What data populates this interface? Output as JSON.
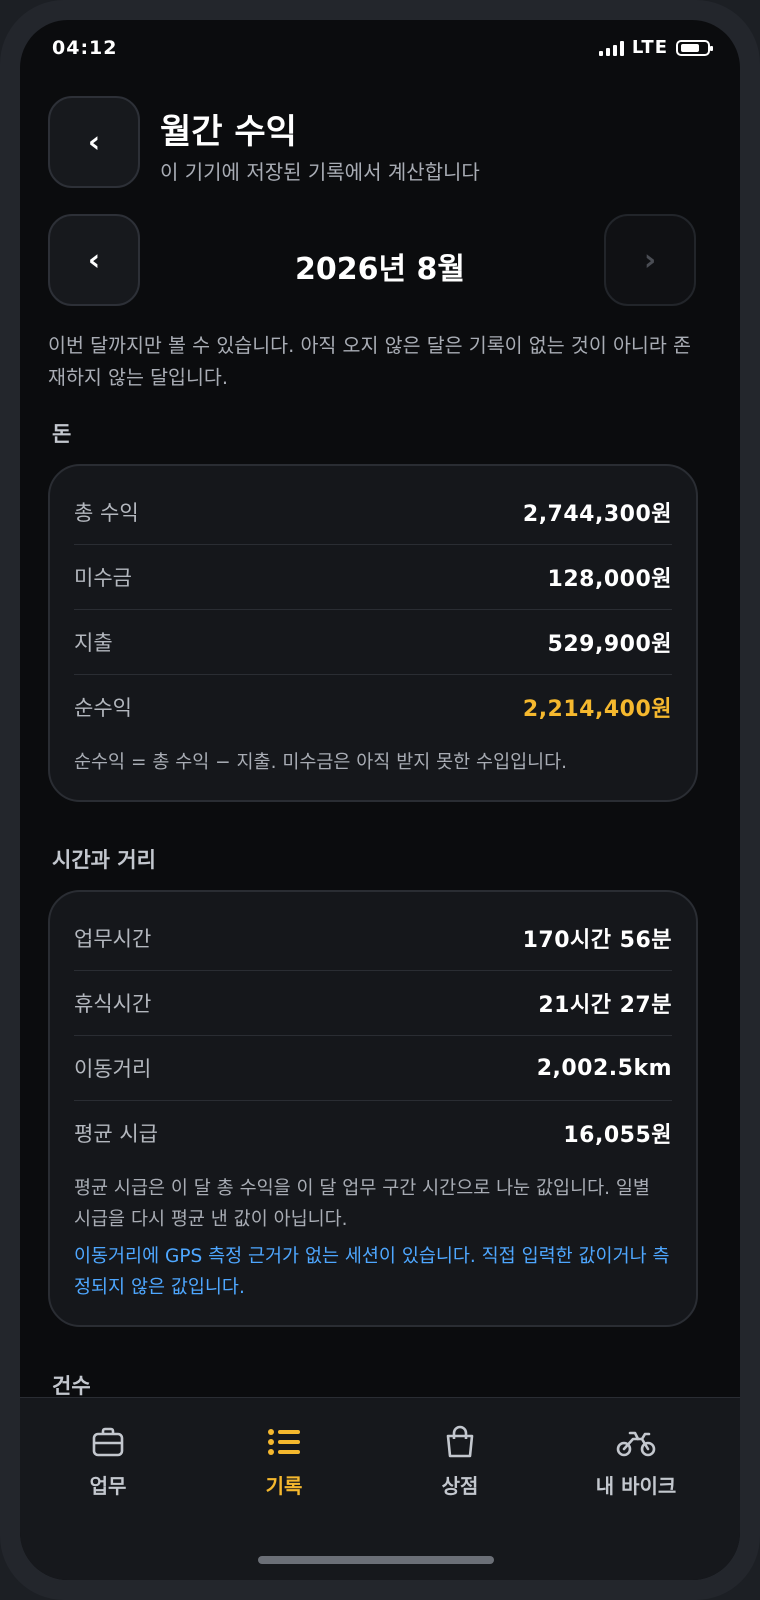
{
  "status": {
    "time": "04:12",
    "network": "LTE"
  },
  "header": {
    "title": "월간 수익",
    "subtitle": "이 기기에 저장된 기록에서 계산합니다",
    "back_glyph": "‹"
  },
  "month_nav": {
    "label": "2026년 8월",
    "prev_glyph": "‹",
    "next_glyph": "›",
    "note": "이번 달까지만 볼 수 있습니다. 아직 오지 않은 달은 기록이 없는 것이 아니라 존재하지 않는 달입니다."
  },
  "money": {
    "section_title": "돈",
    "rows": [
      {
        "label": "총 수익",
        "value": "2,744,300원"
      },
      {
        "label": "미수금",
        "value": "128,000원"
      },
      {
        "label": "지출",
        "value": "529,900원"
      },
      {
        "label": "순수익",
        "value": "2,214,400원"
      }
    ],
    "footnote": "순수익 = 총 수익 − 지출. 미수금은 아직 받지 못한 수입입니다."
  },
  "time_distance": {
    "section_title": "시간과 거리",
    "rows": [
      {
        "label": "업무시간",
        "value": "170시간 56분"
      },
      {
        "label": "휴식시간",
        "value": "21시간 27분"
      },
      {
        "label": "이동거리",
        "value": "2,002.5km"
      },
      {
        "label": "평균 시급",
        "value": "16,055원"
      }
    ],
    "footnote": "평균 시급은 이 달 총 수익을 이 달 업무 구간 시간으로 나눈 값입니다. 일별 시급을 다시 평균 낸 값이 아닙니다.",
    "warning": "이동거리에 GPS 측정 근거가 없는 세션이 있습니다. 직접 입력한 값이거나 측정되지 않은 값입니다."
  },
  "count": {
    "section_title": "건수"
  },
  "tabbar": {
    "items": [
      {
        "label": "업무",
        "icon": "briefcase-icon"
      },
      {
        "label": "기록",
        "icon": "list-icon"
      },
      {
        "label": "상점",
        "icon": "shopping-bag-icon"
      },
      {
        "label": "내 바이크",
        "icon": "bike-icon"
      }
    ],
    "active_index": 1
  },
  "colors": {
    "accent": "#f5b82e",
    "link": "#4ea7ff",
    "background": "#0b0c0e"
  }
}
